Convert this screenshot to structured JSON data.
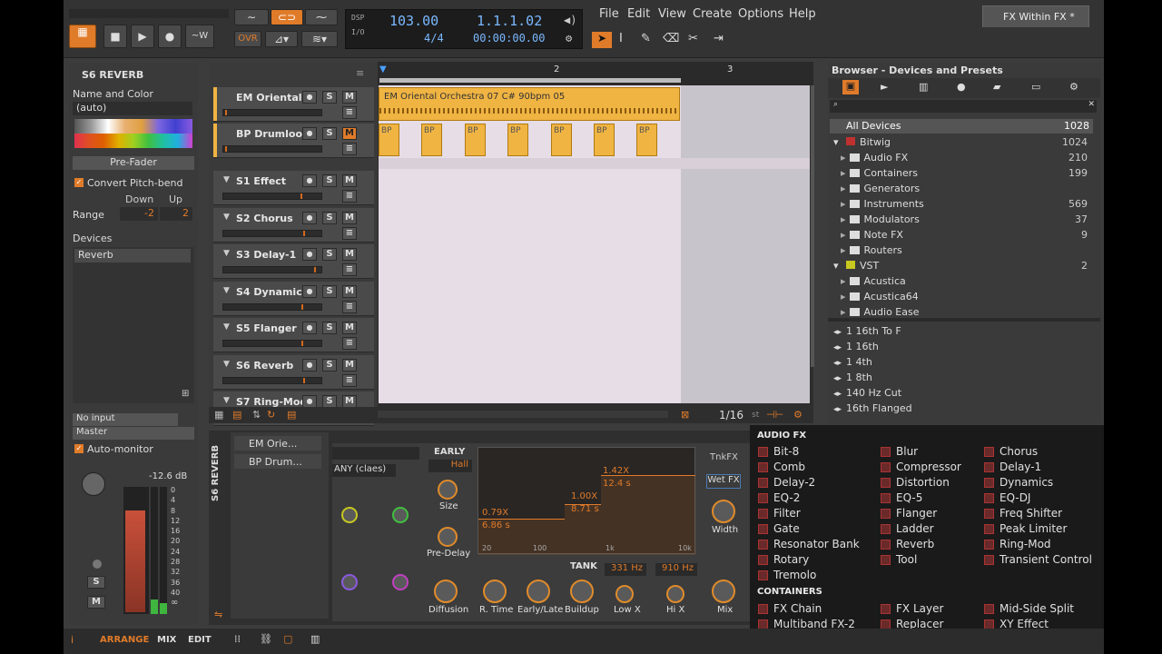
{
  "transport": {
    "dsp": "DSP",
    "io": "I/O",
    "tempo": "103.00",
    "signature": "4/4",
    "position": "1.1.1.02",
    "time": "00:00:00.00",
    "ovr": "OVR",
    "w": "W"
  },
  "menu": [
    "File",
    "Edit",
    "View",
    "Create",
    "Options",
    "Help"
  ],
  "tab": {
    "title": "FX Within FX *"
  },
  "inspector": {
    "title": "S6 REVERB",
    "name_color": "Name and Color",
    "auto": "(auto)",
    "prefader": "Pre-Fader",
    "pitchbend": "Convert Pitch-bend",
    "down": "Down",
    "up": "Up",
    "range": "Range",
    "range_down": "-2",
    "range_up": "2",
    "devices": "Devices",
    "device": "Reverb",
    "input": "No input",
    "output": "Master",
    "automonitor": "Auto-monitor",
    "db": "-12.6 dB",
    "scale": [
      "0",
      "4",
      "8",
      "12",
      "16",
      "20",
      "24",
      "28",
      "32",
      "36",
      "40"
    ],
    "infinity": "∞",
    "s": "S",
    "m": "M"
  },
  "tracks": [
    {
      "name": "EM Oriental...",
      "mute_on": false
    },
    {
      "name": "BP Drumloo...",
      "mute_on": true
    },
    {
      "name": "S1 Effect",
      "mute_on": false
    },
    {
      "name": "S2 Chorus",
      "mute_on": false
    },
    {
      "name": "S3 Delay-1",
      "mute_on": false
    },
    {
      "name": "S4 Dynamics",
      "mute_on": false
    },
    {
      "name": "S5 Flanger",
      "mute_on": false
    },
    {
      "name": "S6 Reverb",
      "mute_on": false
    },
    {
      "name": "S7 Ring-Mod",
      "mute_on": false
    }
  ],
  "arrange": {
    "bar2": "2",
    "bar3": "3",
    "clip1": "EM Oriental Orchestra 07 C# 90bpm 05",
    "bp": "BP",
    "zoom": "1/16",
    "st": "st"
  },
  "browser": {
    "title": "Browser - Devices and Presets",
    "all": "All Devices",
    "all_count": "1028",
    "bitwig": "Bitwig",
    "bitwig_count": "1024",
    "items": [
      {
        "n": "Audio FX",
        "c": "210"
      },
      {
        "n": "Containers",
        "c": "199"
      },
      {
        "n": "Generators",
        "c": ""
      },
      {
        "n": "Instruments",
        "c": "569"
      },
      {
        "n": "Modulators",
        "c": "37"
      },
      {
        "n": "Note FX",
        "c": "9"
      },
      {
        "n": "Routers",
        "c": ""
      }
    ],
    "vst": "VST",
    "vst_count": "2",
    "vst_items": [
      "Acustica",
      "Acustica64",
      "Audio Ease"
    ],
    "presets": [
      "1 16th To F",
      "1 16th",
      "1 4th",
      "1 8th",
      "140 Hz Cut",
      "16th Flanged"
    ]
  },
  "popup": {
    "audio_fx": "AUDIO FX",
    "containers": "CONTAINERS",
    "more": "...",
    "col1": [
      "Bit-8",
      "Comb",
      "Delay-2",
      "EQ-2",
      "Filter",
      "Gate",
      "Resonator Bank",
      "Rotary",
      "Tremolo"
    ],
    "col2": [
      "Blur",
      "Compressor",
      "Distortion",
      "EQ-5",
      "Flanger",
      "Ladder",
      "Reverb",
      "Tool"
    ],
    "col3": [
      "Chorus",
      "Delay-1",
      "Dynamics",
      "EQ-DJ",
      "Freq Shifter",
      "Peak Limiter",
      "Ring-Mod",
      "Transient Control"
    ],
    "cont1": [
      "FX Chain",
      "Multiband FX-2"
    ],
    "cont2": [
      "FX Layer",
      "Replacer"
    ],
    "cont3": [
      "Mid-Side Split",
      "XY Effect"
    ]
  },
  "device": {
    "track": "S6 REVERB",
    "clips": [
      "EM Orie...",
      "BP Drum..."
    ],
    "preset": "ANY (claes)",
    "early": "EARLY",
    "hall": "Hall",
    "size": "Size",
    "predelay": "Pre-Delay",
    "diffusion": "Diffusion",
    "rtime": "R. Time",
    "earlylate": "Early/Late",
    "buildup": "Buildup",
    "lowx": "Low X",
    "hix": "Hi X",
    "mix": "Mix",
    "width": "Width",
    "tank": "TANK",
    "lowhz": "331 Hz",
    "hihz": "910 Hz",
    "tnkfx": "TnkFX",
    "wetfx": "Wet FX",
    "g1": "0.79X",
    "g1s": "6.86 s",
    "g2": "1.00X",
    "g2s": "8.71 s",
    "g3": "1.42X",
    "g3s": "12.4 s",
    "f20": "20",
    "f100": "100",
    "f1k": "1k",
    "f10k": "10k"
  },
  "bottom": {
    "arrange": "ARRANGE",
    "mix": "MIX",
    "edit": "EDIT"
  }
}
